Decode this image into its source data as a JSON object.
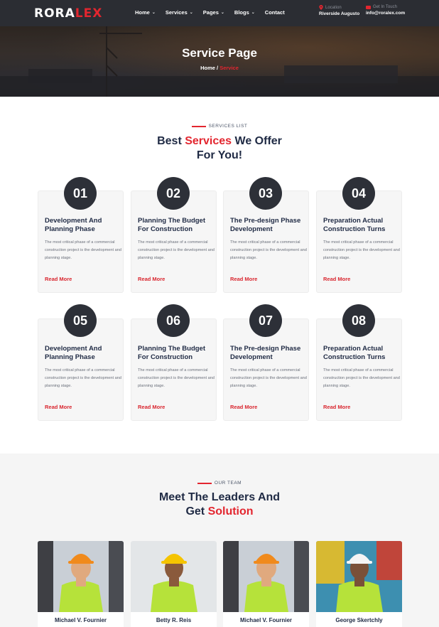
{
  "header": {
    "logo_main": "RORA",
    "logo_accent": "LEX",
    "nav": [
      {
        "label": "Home",
        "dropdown": true
      },
      {
        "label": "Services",
        "dropdown": true
      },
      {
        "label": "Pages",
        "dropdown": true
      },
      {
        "label": "Blogs",
        "dropdown": true
      },
      {
        "label": "Contact",
        "dropdown": false
      }
    ],
    "location_label": "Location",
    "location_value": "Riverside Augusto",
    "contact_label": "Get In Touch",
    "contact_value": "info@roralex.com"
  },
  "hero": {
    "title": "Service Page",
    "breadcrumb_home": "Home",
    "breadcrumb_sep": " / ",
    "breadcrumb_current": "Service"
  },
  "services": {
    "tag": "SERVICES LIST",
    "title_pre": "Best ",
    "title_red": "Services",
    "title_post": " We Offer",
    "title_line2": "For You!",
    "cards": [
      {
        "number": "01",
        "title": "Development And Planning Phase",
        "desc": "The most critical phase of a commercial construction project is the development and planning stage.",
        "link": "Read More"
      },
      {
        "number": "02",
        "title": "Planning The Budget For Construction",
        "desc": "The most critical phase of a commercial construction project is the development and planning stage.",
        "link": "Read More"
      },
      {
        "number": "03",
        "title": "The Pre-design Phase Development",
        "desc": "The most critical phase of a commercial construction project is the development and planning stage.",
        "link": "Read More"
      },
      {
        "number": "04",
        "title": "Preparation Actual Construction Turns",
        "desc": "The most critical phase of a commercial construction project is the development and planning stage.",
        "link": "Read More"
      },
      {
        "number": "05",
        "title": "Development And Planning Phase",
        "desc": "The most critical phase of a commercial construction project is the development and planning stage.",
        "link": "Read More"
      },
      {
        "number": "06",
        "title": "Planning The Budget For Construction",
        "desc": "The most critical phase of a commercial construction project is the development and planning stage.",
        "link": "Read More"
      },
      {
        "number": "07",
        "title": "The Pre-design Phase Development",
        "desc": "The most critical phase of a commercial construction project is the development and planning stage.",
        "link": "Read More"
      },
      {
        "number": "08",
        "title": "Preparation Actual Construction Turns",
        "desc": "The most critical phase of a commercial construction project is the development and planning stage.",
        "link": "Read More"
      }
    ]
  },
  "team": {
    "tag": "OUR TEAM",
    "title_line1": "Meet The Leaders And",
    "title_pre2": "Get ",
    "title_red2": "Solution",
    "members": [
      {
        "name": "Michael V. Fournier",
        "helmet": "#f08a1c",
        "skin": "#e0a97e",
        "bg": "#c9cfd6"
      },
      {
        "name": "Betty R. Reis",
        "helmet": "#f5c400",
        "skin": "#8a5a3c",
        "bg": "#e3e6e8"
      },
      {
        "name": "Michael V. Fournier",
        "helmet": "#f08a1c",
        "skin": "#e0a97e",
        "bg": "#c9cfd6"
      },
      {
        "name": "George Skertchly",
        "helmet": "#f4f4f4",
        "skin": "#7a5038",
        "bg": "#3d8fb0"
      }
    ]
  },
  "colors": {
    "accent": "#e3262f",
    "dark": "#2d3038",
    "navy": "#1f2a44"
  }
}
